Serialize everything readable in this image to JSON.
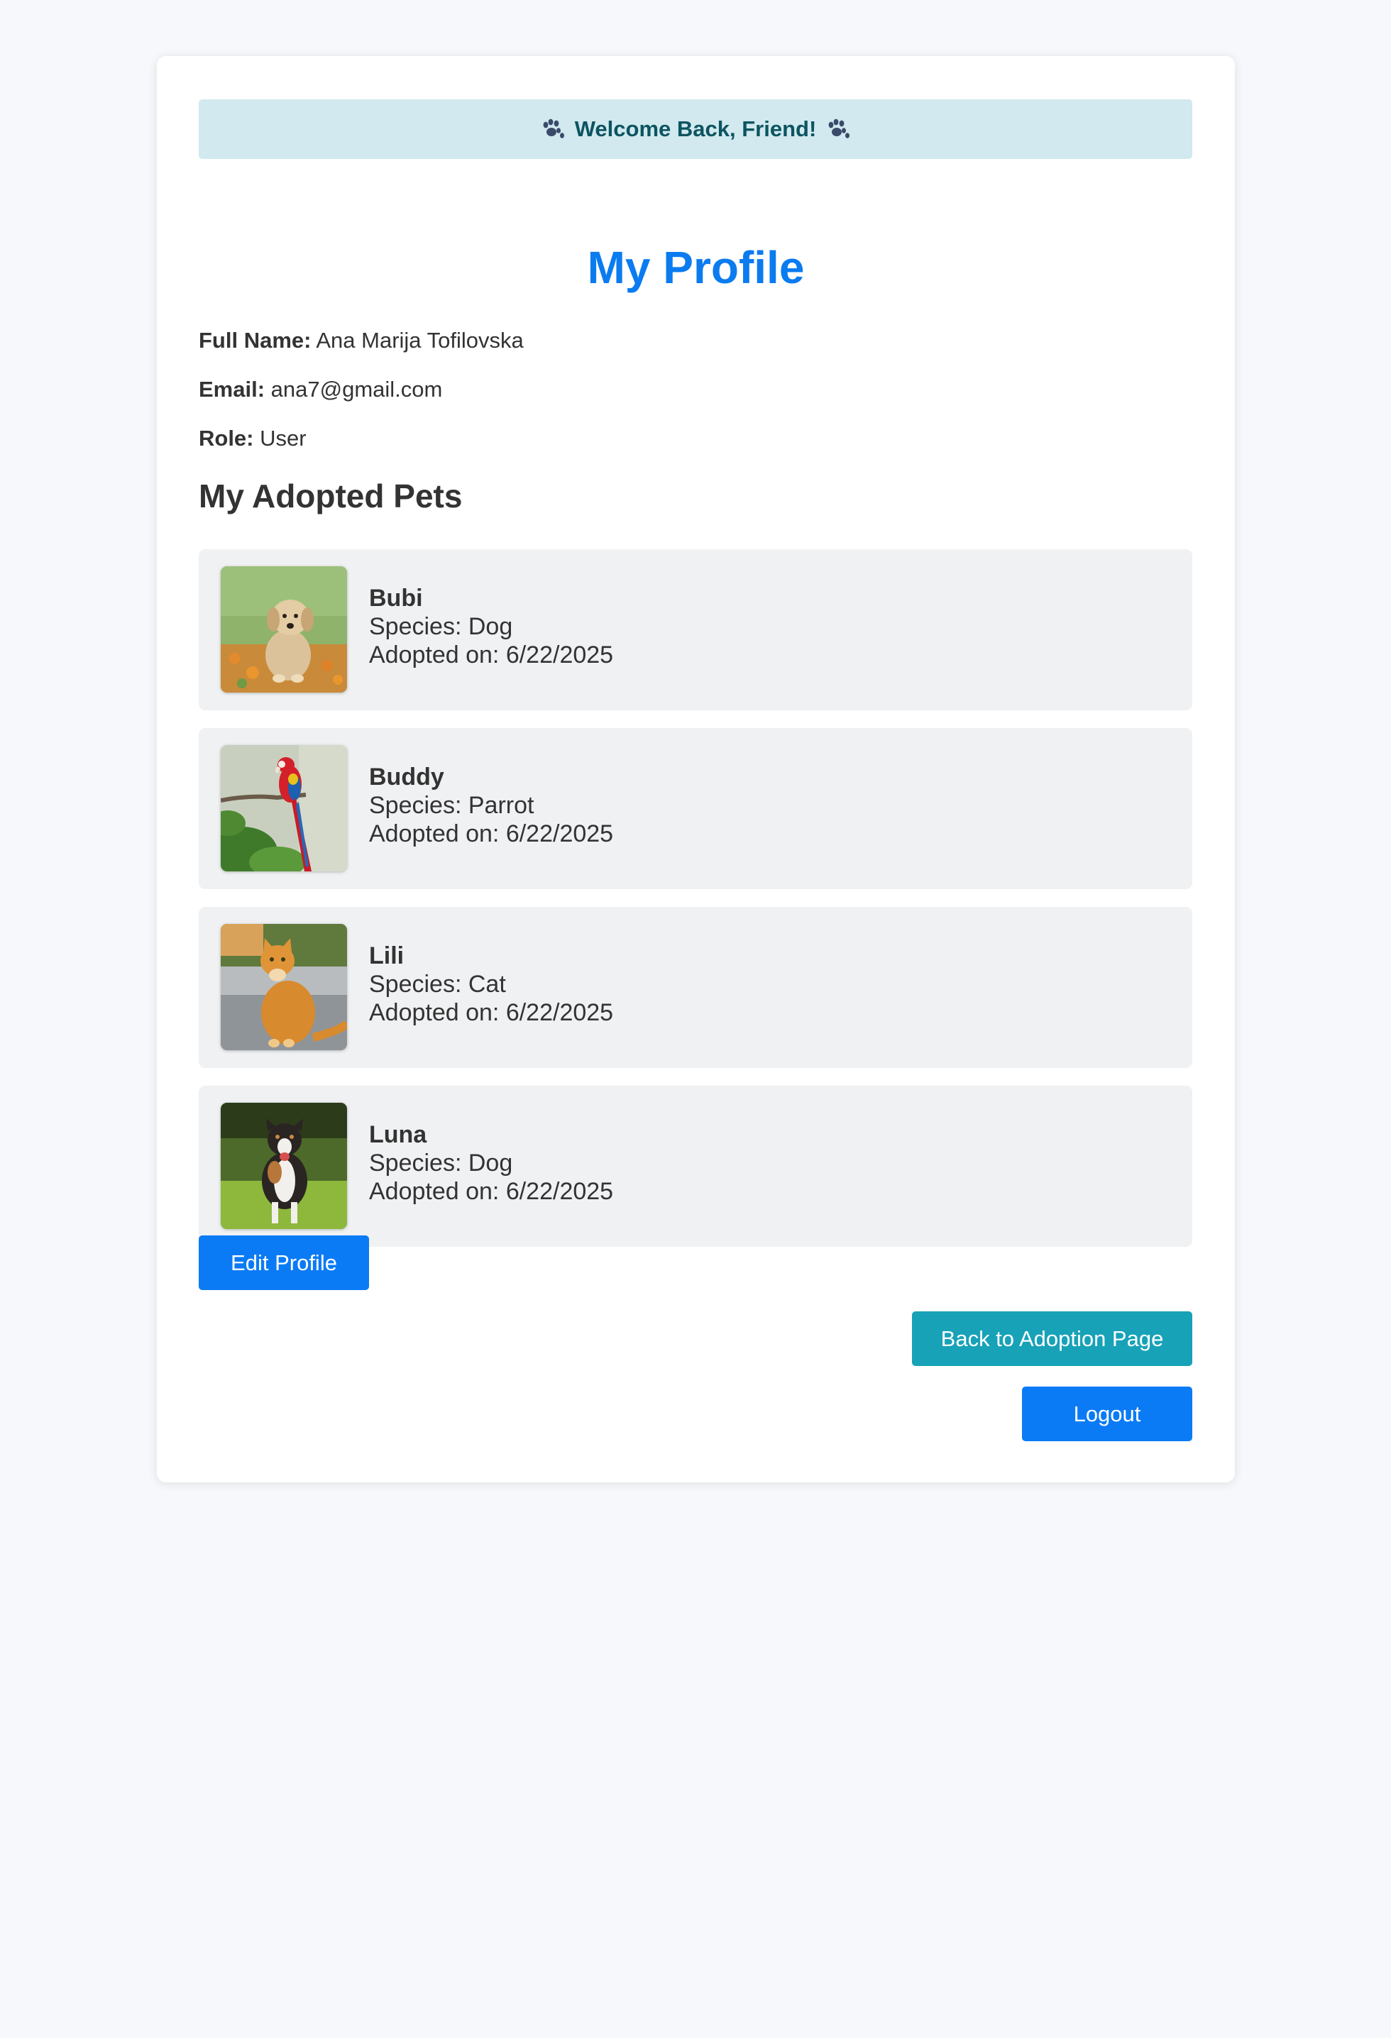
{
  "welcome": {
    "text": "Welcome Back, Friend!",
    "left_icon": "paw-icon",
    "right_icon": "paw-icon"
  },
  "page_title": "My Profile",
  "profile": {
    "full_name_label": "Full Name:",
    "full_name": "Ana Marija Tofilovska",
    "email_label": "Email:",
    "email": "ana7@gmail.com",
    "role_label": "Role:",
    "role": "User"
  },
  "adopted_title": "My Adopted Pets",
  "pets": [
    {
      "name": "Bubi",
      "species": "Species: Dog",
      "adopted": "Adopted on: 6/22/2025",
      "photo": "golden-retriever-puppy-photo"
    },
    {
      "name": "Buddy",
      "species": "Species: Parrot",
      "adopted": "Adopted on: 6/22/2025",
      "photo": "scarlet-macaw-photo"
    },
    {
      "name": "Lili",
      "species": "Species: Cat",
      "adopted": "Adopted on: 6/22/2025",
      "photo": "orange-tabby-cat-photo"
    },
    {
      "name": "Luna",
      "species": "Species: Dog",
      "adopted": "Adopted on: 6/22/2025",
      "photo": "australian-shepherd-photo"
    }
  ],
  "buttons": {
    "edit_profile": "Edit Profile",
    "back": "Back to Adoption Page",
    "logout": "Logout"
  },
  "colors": {
    "page_background": "#f7f8fb",
    "title_blue": "#0b7bf0",
    "welcome_bg": "#d1e9ef",
    "welcome_text": "#0c5460",
    "primary_button": "#0b7bf5",
    "info_button": "#17a2b8",
    "pet_card_bg": "#f0f1f3"
  }
}
